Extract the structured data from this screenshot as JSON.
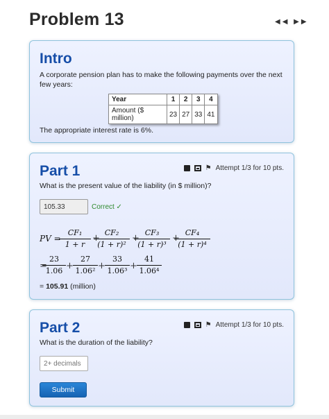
{
  "page": {
    "title": "Problem 13",
    "nav": "◀◀ ▶▶"
  },
  "intro": {
    "title": "Intro",
    "text": "A corporate pension plan has to make the following payments over the next few years:",
    "table": {
      "header": [
        "Year",
        "1",
        "2",
        "3",
        "4"
      ],
      "row": [
        "Amount ($ million)",
        "23",
        "27",
        "33",
        "41"
      ]
    },
    "rate_text": "The appropriate interest rate is 6%."
  },
  "part1": {
    "title": "Part 1",
    "attempt": "Attempt 1/3 for 10 pts.",
    "question": "What is the present value of the liability (in $ million)?",
    "answer": "105.33",
    "feedback": "Correct ✓",
    "formula": {
      "lhs": "PV =",
      "numerators": [
        "CF₁",
        "CF₂",
        "CF₃",
        "CF₄"
      ],
      "denominators": [
        "1 + r",
        "(1 + r)²",
        "(1 + r)³",
        "(1 + r)⁴"
      ],
      "values": [
        "23",
        "27",
        "33",
        "41"
      ],
      "value_denominators": [
        "1.06",
        "1.06²",
        "1.06³",
        "1.06⁴"
      ],
      "eq": "=",
      "plus": "+"
    },
    "result_value": "105.91",
    "result_unit": " (million)",
    "result_eq": "= "
  },
  "part2": {
    "title": "Part 2",
    "attempt": "Attempt 1/3 for 10 pts.",
    "question": "What is the duration of the liability?",
    "placeholder": "2+ decimals",
    "submit": "Submit"
  }
}
